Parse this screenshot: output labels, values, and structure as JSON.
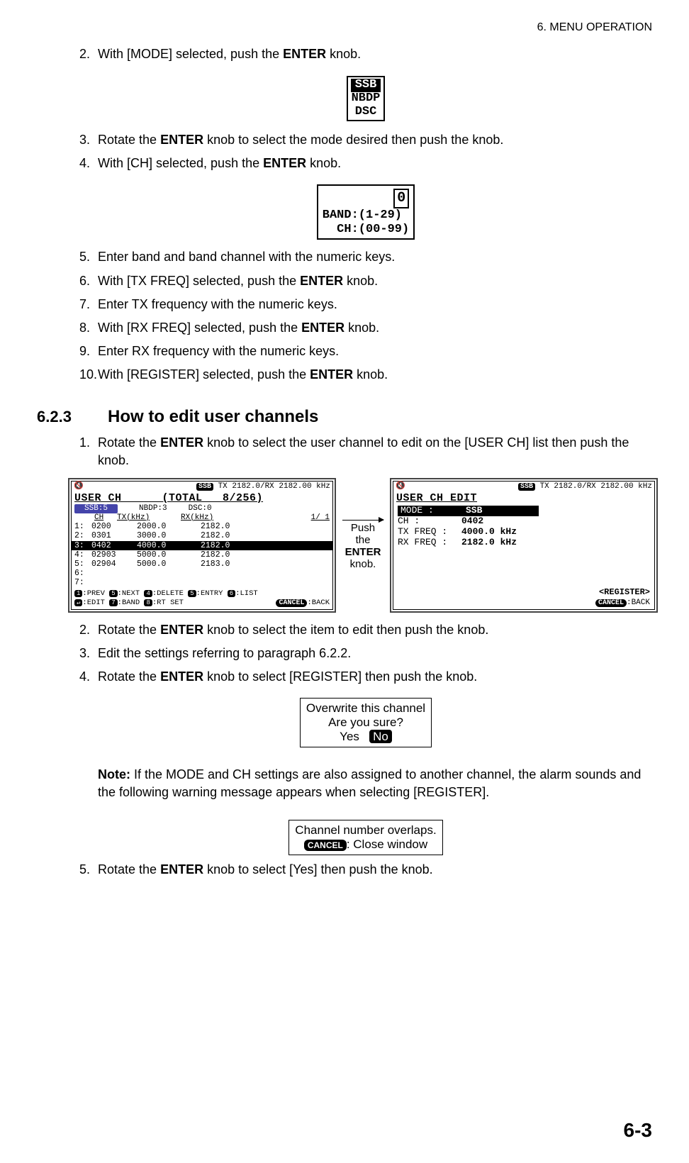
{
  "header": {
    "chapter": "6.  MENU OPERATION"
  },
  "page_number": "6-3",
  "steps_part1": [
    {
      "n": "2.",
      "pre": "With [MODE] selected, push the ",
      "b": "ENTER",
      "post": " knob."
    }
  ],
  "mode_box": {
    "l1": "SSB",
    "l2": "NBDP",
    "l3": "DSC"
  },
  "steps_part2": [
    {
      "n": "3.",
      "pre": "Rotate the ",
      "b": "ENTER",
      "post": " knob to select the mode desired then push the knob."
    },
    {
      "n": "4.",
      "pre": "With [CH] selected, push the ",
      "b": "ENTER",
      "post": " knob."
    }
  ],
  "band_box": {
    "zero": "0",
    "line1": "BAND:(1-29)",
    "line2": "  CH:(00-99)"
  },
  "steps_part3": [
    {
      "n": "5.",
      "plain": "Enter band and band channel with the numeric keys."
    },
    {
      "n": "6.",
      "pre": "With [TX FREQ] selected, push the ",
      "b": "ENTER",
      "post": " knob."
    },
    {
      "n": "7.",
      "plain": "Enter TX frequency with the numeric keys."
    },
    {
      "n": "8.",
      "pre": "With [RX FREQ] selected, push the ",
      "b": "ENTER",
      "post": " knob."
    },
    {
      "n": "9.",
      "plain": "Enter RX frequency with the numeric keys."
    },
    {
      "n": "10.",
      "pre": "With [REGISTER] selected, push the ",
      "b": "ENTER",
      "post": " knob."
    }
  ],
  "section": {
    "num": "6.2.3",
    "title": "How to edit user channels"
  },
  "steps_part4": [
    {
      "n": "1.",
      "pre": "Rotate the ",
      "b": "ENTER",
      "post": " knob to select the user channel to edit on the [USER CH] list then push the knob."
    }
  ],
  "screen1": {
    "top": "TX 2182.0/RX 2182.00 kHz",
    "title": "USER CH      (TOTAL   8/256)",
    "tabs": {
      "active": "SSB:5",
      "t2": "NBDP:3",
      "t3": "DSC:0"
    },
    "head": {
      "c1": "CH",
      "c2": "TX(kHz)",
      "c3": "RX(kHz)",
      "c4": "1/ 1"
    },
    "rows": [
      {
        "n": "1:",
        "ch": "0200",
        "tx": "2000.0",
        "rx": "2182.0"
      },
      {
        "n": "2:",
        "ch": "0301",
        "tx": "3000.0",
        "rx": "2182.0"
      },
      {
        "n": "3:",
        "ch": "0402",
        "tx": "4000.0",
        "rx": "2182.0",
        "sel": true
      },
      {
        "n": "4:",
        "ch": "02903",
        "tx": "5000.0",
        "rx": "2182.0"
      },
      {
        "n": "5:",
        "ch": "02904",
        "tx": "5000.0",
        "rx": "2183.0"
      },
      {
        "n": "6:",
        "ch": "",
        "tx": "",
        "rx": ""
      },
      {
        "n": "7:",
        "ch": "",
        "tx": "",
        "rx": ""
      }
    ],
    "foot1_a": "1",
    "foot1_b": ":PREV ",
    "foot1_c": "5",
    "foot1_d": ":NEXT ",
    "foot1_e": "4",
    "foot1_f": ":DELETE ",
    "foot1_g": "5",
    "foot1_h": ":ENTRY ",
    "foot1_i": "6",
    "foot1_j": ":LIST",
    "foot2_a": "↵",
    "foot2_b": ":EDIT ",
    "foot2_c": "7",
    "foot2_d": ":BAND ",
    "foot2_e": "8",
    "foot2_f": ":RT SET",
    "foot2_g": "CANCEL",
    "foot2_h": ":BACK"
  },
  "arrow_text": {
    "l1": "Push",
    "l2": "the",
    "l3": "ENTER",
    "l4": "knob."
  },
  "screen2": {
    "top": "TX 2182.0/RX 2182.00 kHz",
    "title": "USER CH EDIT",
    "fields": [
      {
        "lab": "MODE   :",
        "val": "SSB",
        "mode": true
      },
      {
        "lab": "CH     :",
        "val": "0402"
      },
      {
        "lab": "TX FREQ :",
        "val": "4000.0 kHz"
      },
      {
        "lab": "RX FREQ :",
        "val": "2182.0 kHz"
      }
    ],
    "register": "<REGISTER>",
    "cancel": "CANCEL",
    "back": ":BACK"
  },
  "steps_part5": [
    {
      "n": "2.",
      "pre": "Rotate the ",
      "b": "ENTER",
      "post": " knob to select the item to edit then push the knob."
    },
    {
      "n": "3.",
      "plain": "Edit the settings referring to paragraph 6.2.2."
    },
    {
      "n": "4.",
      "pre": "Rotate the ",
      "b": "ENTER",
      "post": " knob to select [REGISTER] then push the knob."
    }
  ],
  "dialog1": {
    "l1": "Overwrite this channel",
    "l2": "Are you sure?",
    "yes": "Yes",
    "no": "No"
  },
  "note": {
    "b": "Note:",
    "text": " If the MODE and CH settings are also assigned to another channel, the alarm sounds and the following warning message appears when selecting [REGISTER]."
  },
  "dialog2": {
    "l1": "Channel number overlaps.",
    "cancel": "CANCEL",
    "l2": ": Close window"
  },
  "steps_part6": [
    {
      "n": "5.",
      "pre": "Rotate the ",
      "b": "ENTER",
      "post": " knob to select [Yes] then push the knob."
    }
  ]
}
